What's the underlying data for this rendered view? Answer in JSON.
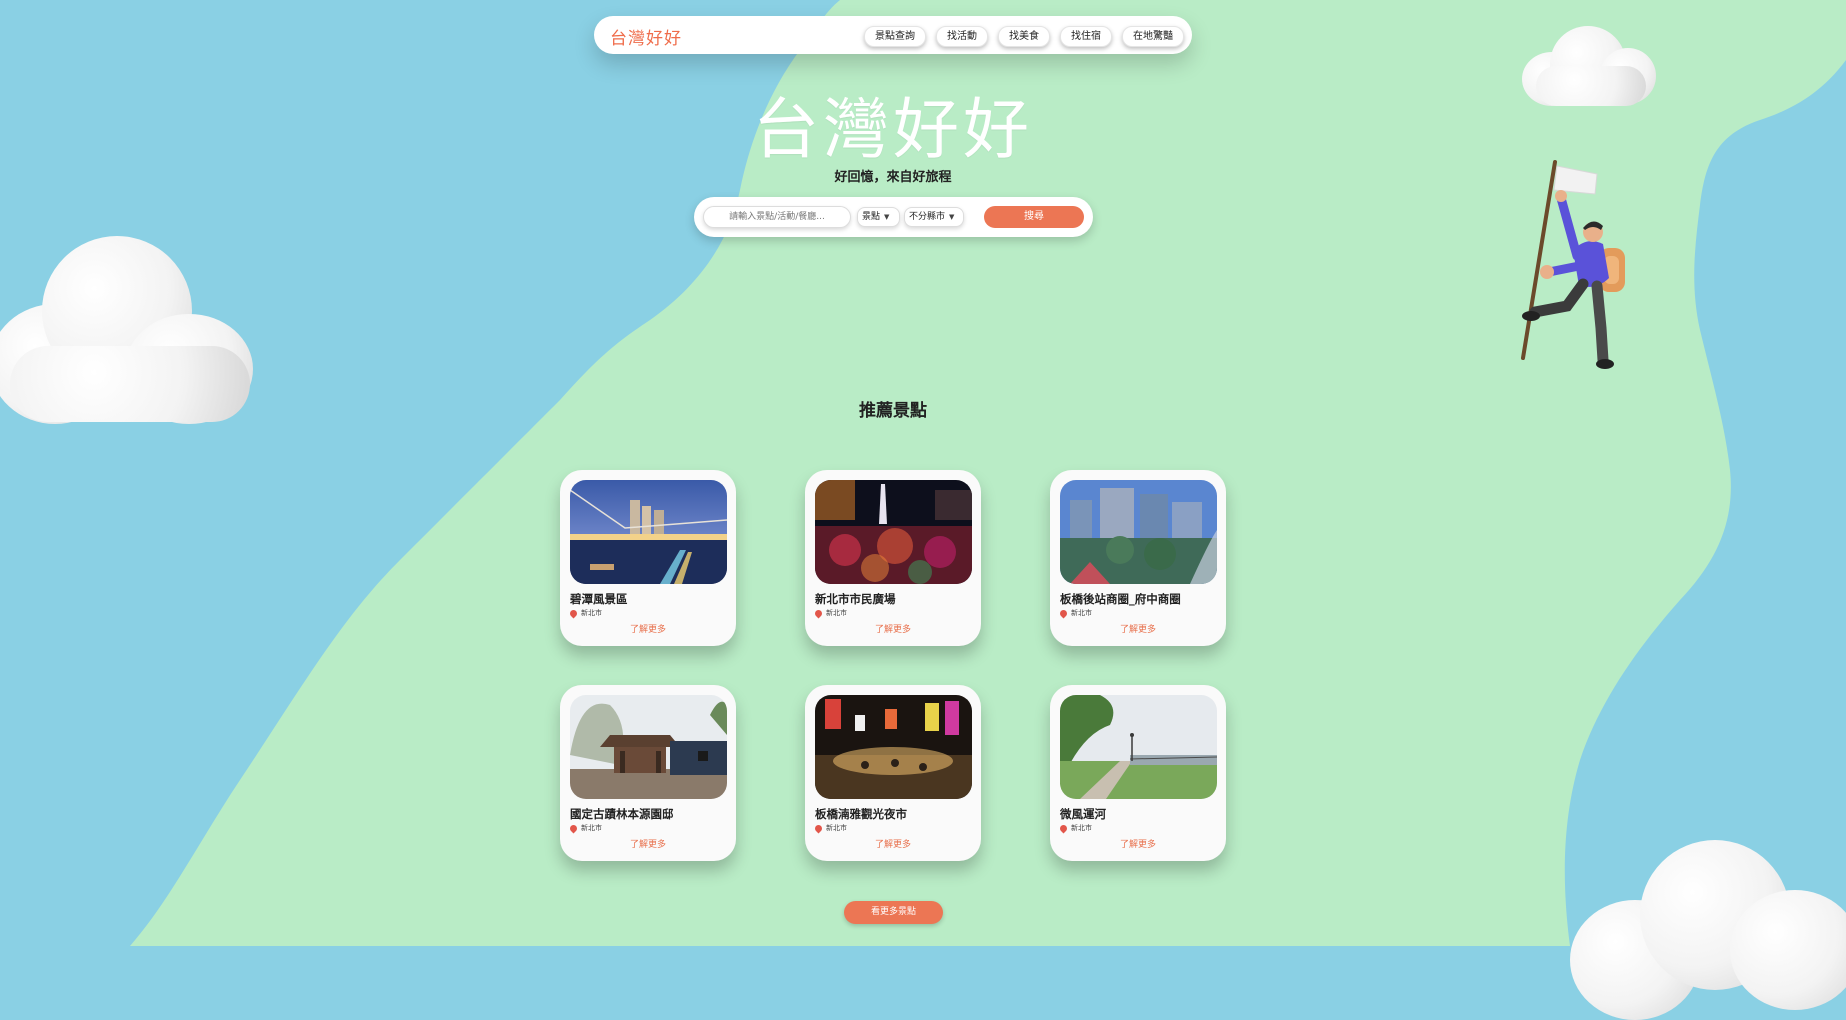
{
  "nav": {
    "brand": "台灣好好",
    "links": [
      "景點查詢",
      "找活動",
      "找美食",
      "找住宿",
      "在地驚豔"
    ]
  },
  "hero": {
    "title": "台灣好好",
    "subtitle": "好回憶，來自好旅程"
  },
  "search": {
    "placeholder": "請輸入景點/活動/餐廳...",
    "category_selected": "景點",
    "city_selected": "不分縣市",
    "button_label": "搜尋"
  },
  "recommend": {
    "title": "推薦景點",
    "more_label": "了解更多",
    "cards": [
      {
        "name": "碧潭風景區",
        "city": "新北市",
        "image": "night-river-bridge"
      },
      {
        "name": "新北市市民廣場",
        "city": "新北市",
        "image": "night-concert-crowd"
      },
      {
        "name": "板橋後站商圈_府中商圈",
        "city": "新北市",
        "image": "city-plaza-buildings"
      },
      {
        "name": "國定古蹟林本源園邸",
        "city": "新北市",
        "image": "traditional-pavilion"
      },
      {
        "name": "板橋湳雅觀光夜市",
        "city": "新北市",
        "image": "night-market-street"
      },
      {
        "name": "微風運河",
        "city": "新北市",
        "image": "riverside-path"
      }
    ],
    "view_more_button": "看更多景點"
  },
  "colors": {
    "background_blue": "#8ad0e4",
    "land_green": "#b9ecc6",
    "accent_orange": "#ec7654"
  }
}
